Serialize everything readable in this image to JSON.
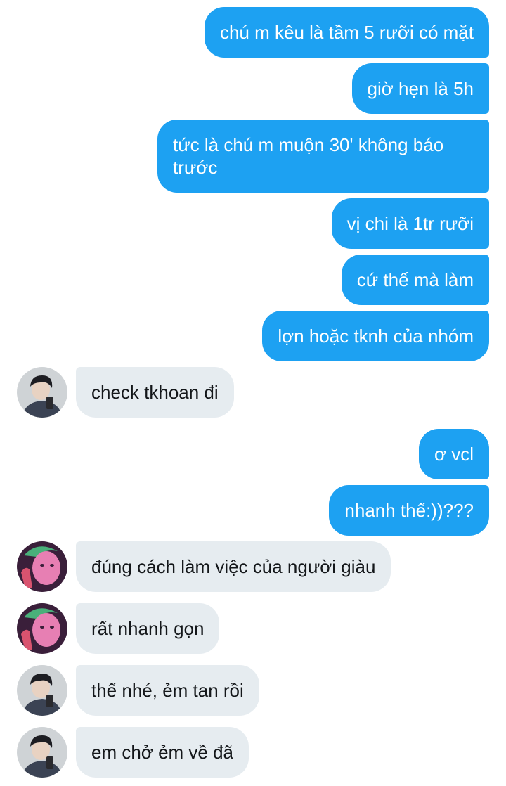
{
  "messages": [
    {
      "direction": "out",
      "text": "chú m kêu là tầm 5 rưỡi có mặt"
    },
    {
      "direction": "out",
      "text": "giờ hẹn là 5h"
    },
    {
      "direction": "out",
      "text": "tức là chú m muộn 30' không báo trước"
    },
    {
      "direction": "out",
      "text": "vị chi là 1tr rưỡi"
    },
    {
      "direction": "out",
      "text": "cứ thế mà làm"
    },
    {
      "direction": "out",
      "text": "lợn hoặc tknh của nhóm"
    },
    {
      "direction": "in",
      "sender_avatar": "avatar-boy",
      "text": "check tkhoan đi"
    },
    {
      "direction": "out",
      "text": "ơ vcl"
    },
    {
      "direction": "out",
      "text": "nhanh thế:))???"
    },
    {
      "direction": "in",
      "sender_avatar": "avatar-pink",
      "text": "đúng cách làm việc của người giàu"
    },
    {
      "direction": "in",
      "sender_avatar": "avatar-pink",
      "text": "rất nhanh gọn"
    },
    {
      "direction": "in",
      "sender_avatar": "avatar-boy",
      "text": "thế nhé, ẻm tan rồi"
    },
    {
      "direction": "in",
      "sender_avatar": "avatar-boy",
      "text": "em chở ẻm về đã"
    }
  ],
  "colors": {
    "outgoing_bubble": "#1da1f2",
    "incoming_bubble": "#e6ecf0",
    "outgoing_text": "#ffffff",
    "incoming_text": "#14171a"
  }
}
